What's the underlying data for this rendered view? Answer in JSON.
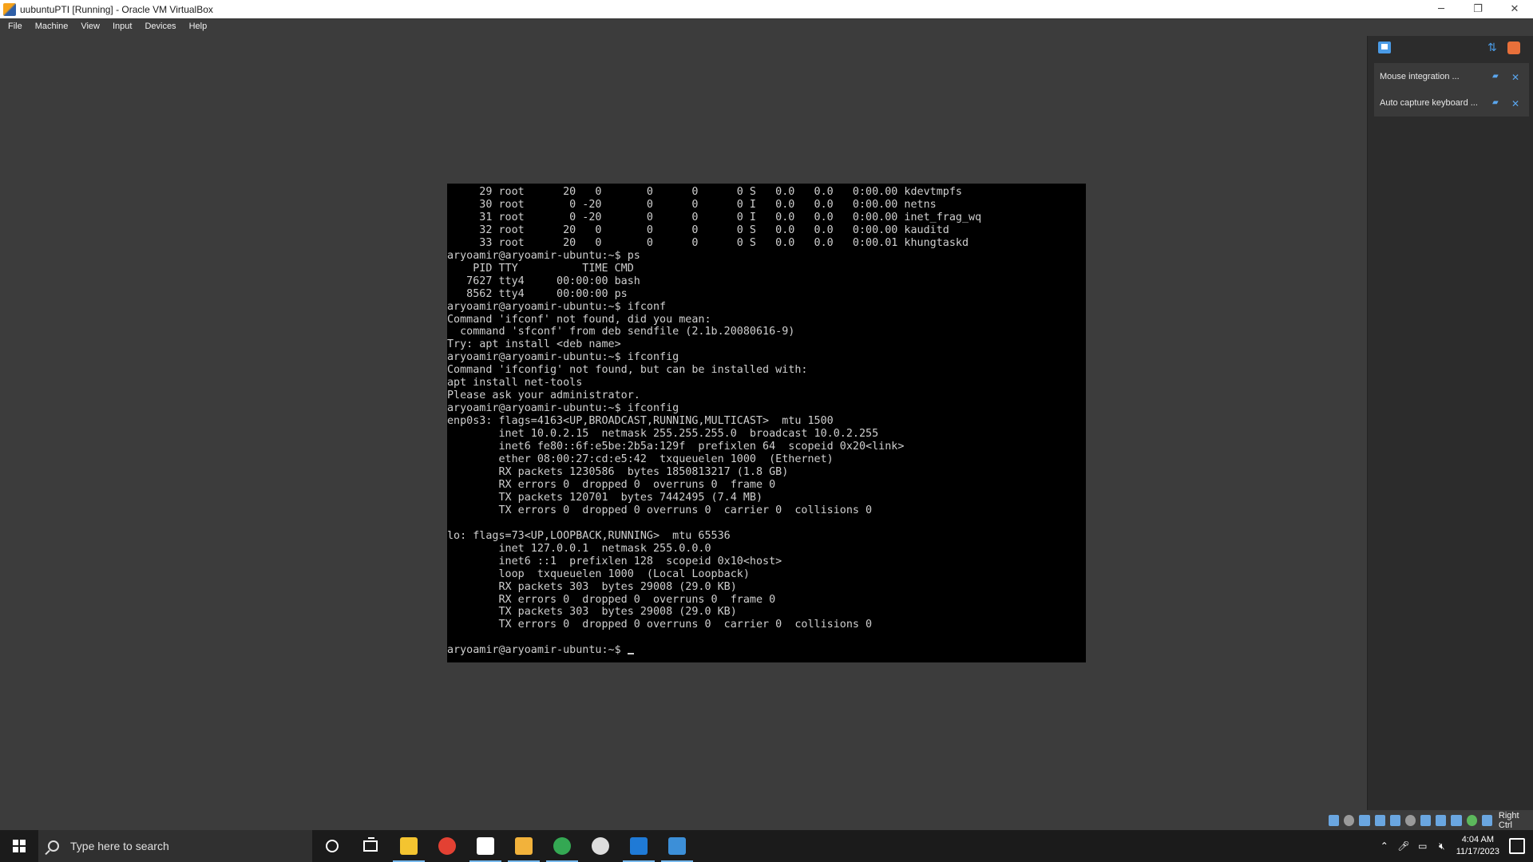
{
  "window": {
    "title": "uubuntuPTI [Running] - Oracle VM VirtualBox",
    "controls": [
      "─",
      "❐",
      "✕"
    ]
  },
  "menu": {
    "items": [
      "File",
      "Machine",
      "View",
      "Input",
      "Devices",
      "Help"
    ]
  },
  "terminal": {
    "lines": [
      "     29 root      20   0       0      0      0 S   0.0   0.0   0:00.00 kdevtmpfs",
      "     30 root       0 -20       0      0      0 I   0.0   0.0   0:00.00 netns",
      "     31 root       0 -20       0      0      0 I   0.0   0.0   0:00.00 inet_frag_wq",
      "     32 root      20   0       0      0      0 S   0.0   0.0   0:00.00 kauditd",
      "     33 root      20   0       0      0      0 S   0.0   0.0   0:00.01 khungtaskd",
      "aryoamir@aryoamir-ubuntu:~$ ps",
      "    PID TTY          TIME CMD",
      "   7627 tty4     00:00:00 bash",
      "   8562 tty4     00:00:00 ps",
      "aryoamir@aryoamir-ubuntu:~$ ifconf",
      "Command 'ifconf' not found, did you mean:",
      "  command 'sfconf' from deb sendfile (2.1b.20080616-9)",
      "Try: apt install <deb name>",
      "aryoamir@aryoamir-ubuntu:~$ ifconfig",
      "Command 'ifconfig' not found, but can be installed with:",
      "apt install net-tools",
      "Please ask your administrator.",
      "aryoamir@aryoamir-ubuntu:~$ ifconfig",
      "enp0s3: flags=4163<UP,BROADCAST,RUNNING,MULTICAST>  mtu 1500",
      "        inet 10.0.2.15  netmask 255.255.255.0  broadcast 10.0.2.255",
      "        inet6 fe80::6f:e5be:2b5a:129f  prefixlen 64  scopeid 0x20<link>",
      "        ether 08:00:27:cd:e5:42  txqueuelen 1000  (Ethernet)",
      "        RX packets 1230586  bytes 1850813217 (1.8 GB)",
      "        RX errors 0  dropped 0  overruns 0  frame 0",
      "        TX packets 120701  bytes 7442495 (7.4 MB)",
      "        TX errors 0  dropped 0 overruns 0  carrier 0  collisions 0",
      "",
      "lo: flags=73<UP,LOOPBACK,RUNNING>  mtu 65536",
      "        inet 127.0.0.1  netmask 255.0.0.0",
      "        inet6 ::1  prefixlen 128  scopeid 0x10<host>",
      "        loop  txqueuelen 1000  (Local Loopback)",
      "        RX packets 303  bytes 29008 (29.0 KB)",
      "        RX errors 0  dropped 0  overruns 0  frame 0",
      "        TX packets 303  bytes 29008 (29.0 KB)",
      "        TX errors 0  dropped 0 overruns 0  carrier 0  collisions 0",
      "",
      "aryoamir@aryoamir-ubuntu:~$ "
    ]
  },
  "notifications": {
    "items": [
      {
        "text": "Mouse integration ..."
      },
      {
        "text": "Auto capture keyboard ..."
      }
    ]
  },
  "vbox_status": {
    "host_key": "Right Ctrl"
  },
  "taskbar": {
    "search_placeholder": "Type here to search",
    "apps": [
      {
        "name": "file-explorer",
        "color": "#f4c430",
        "active": true
      },
      {
        "name": "chrome",
        "color": "#e34133",
        "active": false
      },
      {
        "name": "virtualbox",
        "color": "#ffffff",
        "active": true
      },
      {
        "name": "drawing-app",
        "color": "#f2b23b",
        "active": true
      },
      {
        "name": "chrome-profile",
        "color": "#34a853",
        "active": true
      },
      {
        "name": "obs",
        "color": "#dddddd",
        "active": false
      },
      {
        "name": "media-player",
        "color": "#1f7ad6",
        "active": true
      },
      {
        "name": "photos",
        "color": "#3c8fd8",
        "active": true
      }
    ],
    "time": "4:04 AM",
    "date": "11/17/2023"
  }
}
